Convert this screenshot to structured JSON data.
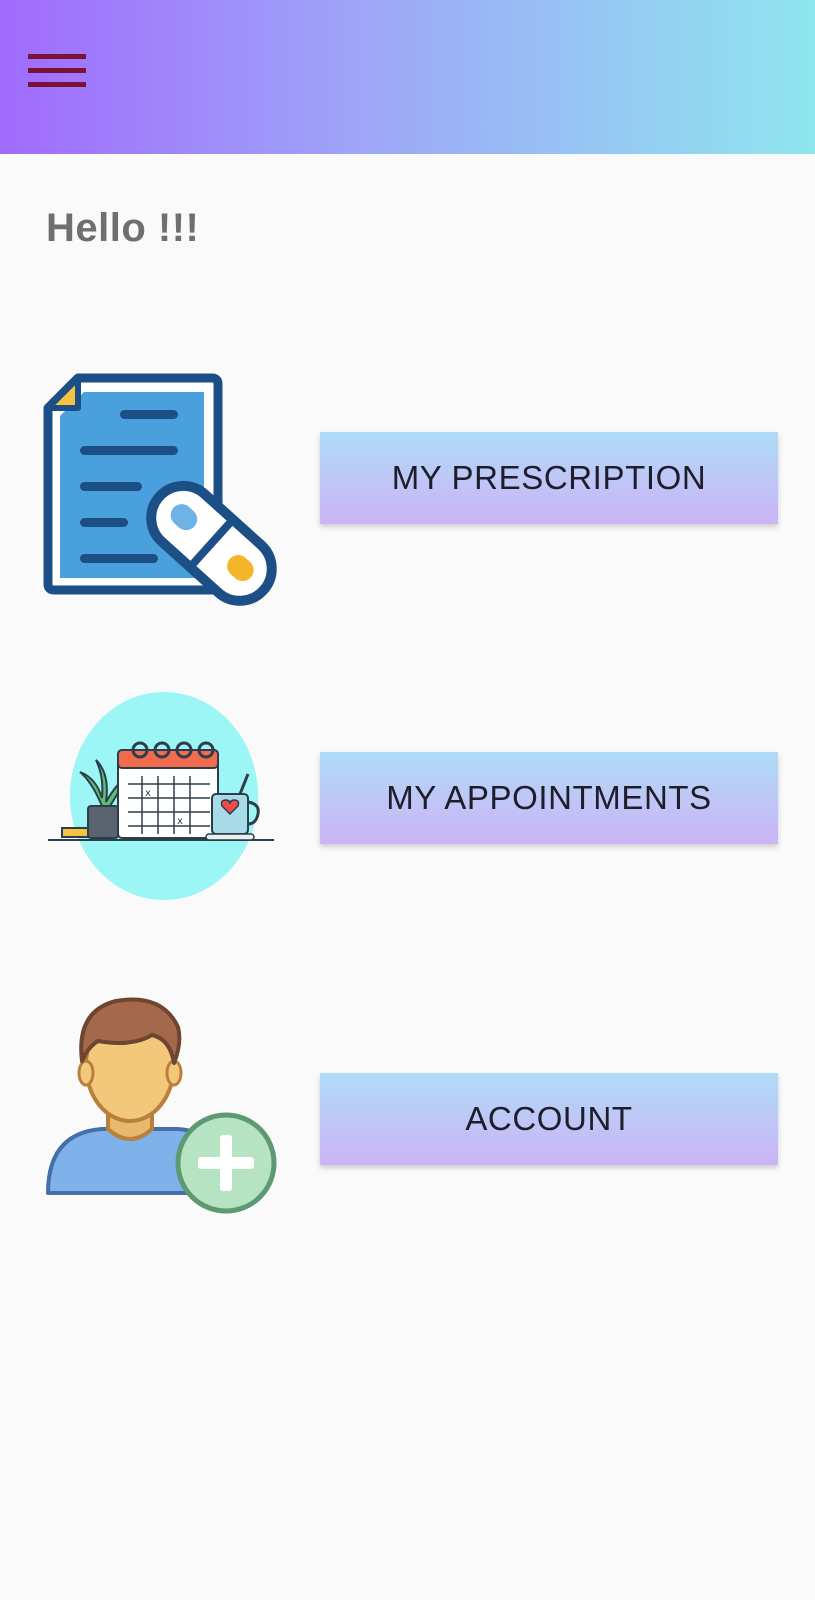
{
  "header": {
    "menu_icon": "hamburger-menu-icon",
    "gradient_colors": [
      "#a06bfd",
      "#9ea6f8",
      "#8ee6ee"
    ],
    "menu_icon_color": "#7a1235"
  },
  "greeting": "Hello !!!",
  "menu": [
    {
      "icon": "prescription-document-pill-icon",
      "label": "MY PRESCRIPTION"
    },
    {
      "icon": "calendar-appointment-icon",
      "label": "MY APPOINTMENTS"
    },
    {
      "icon": "add-user-account-icon",
      "label": "ACCOUNT"
    }
  ],
  "button_gradient": [
    "#aedcf7",
    "#cdb3f6"
  ]
}
